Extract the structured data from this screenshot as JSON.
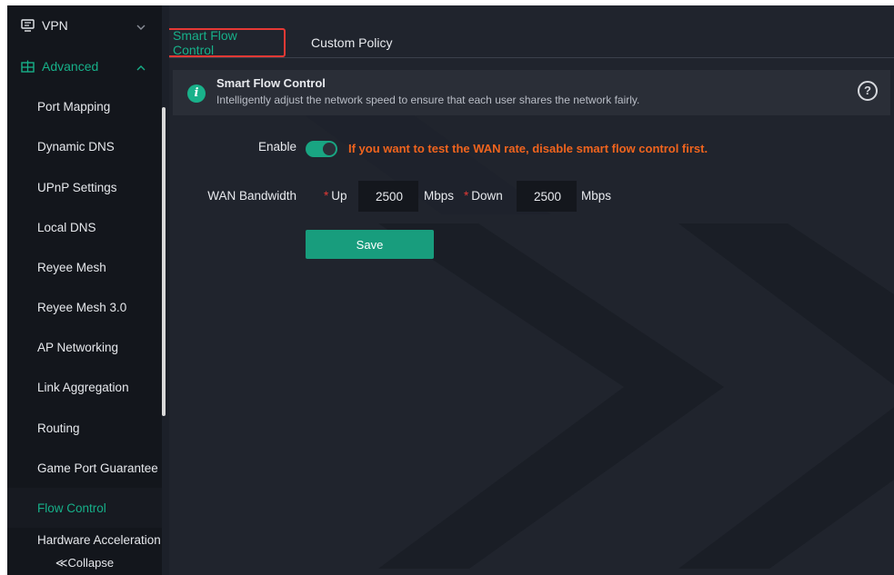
{
  "sidebar": {
    "groups": [
      {
        "label": "VPN",
        "icon": "monitor-icon",
        "expanded": false
      },
      {
        "label": "Advanced",
        "icon": "grid-icon",
        "expanded": true
      }
    ],
    "items": [
      {
        "label": "Port Mapping"
      },
      {
        "label": "Dynamic DNS"
      },
      {
        "label": "UPnP Settings"
      },
      {
        "label": "Local DNS"
      },
      {
        "label": "Reyee Mesh"
      },
      {
        "label": "Reyee Mesh 3.0"
      },
      {
        "label": "AP Networking"
      },
      {
        "label": "Link Aggregation"
      },
      {
        "label": "Routing"
      },
      {
        "label": "Game Port Guarantee"
      },
      {
        "label": "Flow Control",
        "active": true
      },
      {
        "label": "Hardware Acceleration"
      }
    ],
    "collapse_label": "≪Collapse"
  },
  "tabs": [
    {
      "label": "Smart Flow Control",
      "active": true
    },
    {
      "label": "Custom Policy",
      "active": false
    }
  ],
  "banner": {
    "title": "Smart Flow Control",
    "description": "Intelligently adjust the network speed to ensure that each user shares the network fairly.",
    "info_glyph": "i",
    "help_glyph": "?"
  },
  "form": {
    "enable_label": "Enable",
    "enabled": true,
    "warning": "If you want to test the WAN rate, disable smart flow control first.",
    "wan_bandwidth_label": "WAN Bandwidth",
    "required_mark": "*",
    "up_label": "Up",
    "up_value": "2500",
    "up_unit": "Mbps",
    "down_label": "Down",
    "down_value": "2500",
    "down_unit": "Mbps",
    "save_label": "Save"
  },
  "colors": {
    "accent": "#17b089",
    "warning": "#f0641e",
    "required": "#e53935",
    "highlight_border": "#e53935"
  }
}
